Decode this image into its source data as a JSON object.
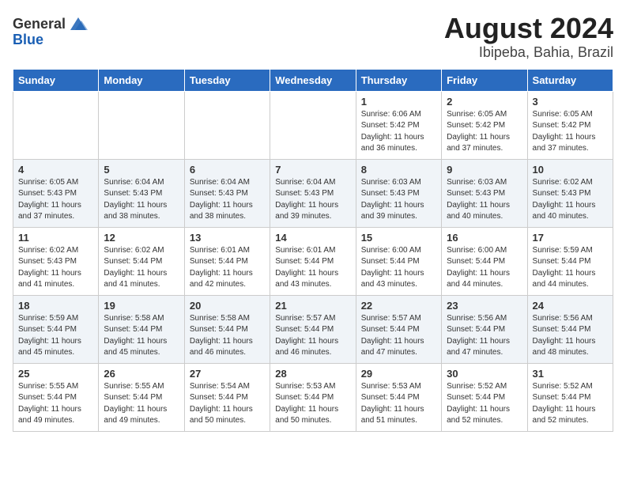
{
  "header": {
    "logo_general": "General",
    "logo_blue": "Blue",
    "title": "August 2024",
    "subtitle": "Ibipeba, Bahia, Brazil"
  },
  "days_of_week": [
    "Sunday",
    "Monday",
    "Tuesday",
    "Wednesday",
    "Thursday",
    "Friday",
    "Saturday"
  ],
  "weeks": [
    {
      "cells": [
        {
          "day": "",
          "info": ""
        },
        {
          "day": "",
          "info": ""
        },
        {
          "day": "",
          "info": ""
        },
        {
          "day": "",
          "info": ""
        },
        {
          "day": "1",
          "info": "Sunrise: 6:06 AM\nSunset: 5:42 PM\nDaylight: 11 hours and 36 minutes."
        },
        {
          "day": "2",
          "info": "Sunrise: 6:05 AM\nSunset: 5:42 PM\nDaylight: 11 hours and 37 minutes."
        },
        {
          "day": "3",
          "info": "Sunrise: 6:05 AM\nSunset: 5:42 PM\nDaylight: 11 hours and 37 minutes."
        }
      ]
    },
    {
      "cells": [
        {
          "day": "4",
          "info": "Sunrise: 6:05 AM\nSunset: 5:43 PM\nDaylight: 11 hours and 37 minutes."
        },
        {
          "day": "5",
          "info": "Sunrise: 6:04 AM\nSunset: 5:43 PM\nDaylight: 11 hours and 38 minutes."
        },
        {
          "day": "6",
          "info": "Sunrise: 6:04 AM\nSunset: 5:43 PM\nDaylight: 11 hours and 38 minutes."
        },
        {
          "day": "7",
          "info": "Sunrise: 6:04 AM\nSunset: 5:43 PM\nDaylight: 11 hours and 39 minutes."
        },
        {
          "day": "8",
          "info": "Sunrise: 6:03 AM\nSunset: 5:43 PM\nDaylight: 11 hours and 39 minutes."
        },
        {
          "day": "9",
          "info": "Sunrise: 6:03 AM\nSunset: 5:43 PM\nDaylight: 11 hours and 40 minutes."
        },
        {
          "day": "10",
          "info": "Sunrise: 6:02 AM\nSunset: 5:43 PM\nDaylight: 11 hours and 40 minutes."
        }
      ]
    },
    {
      "cells": [
        {
          "day": "11",
          "info": "Sunrise: 6:02 AM\nSunset: 5:43 PM\nDaylight: 11 hours and 41 minutes."
        },
        {
          "day": "12",
          "info": "Sunrise: 6:02 AM\nSunset: 5:44 PM\nDaylight: 11 hours and 41 minutes."
        },
        {
          "day": "13",
          "info": "Sunrise: 6:01 AM\nSunset: 5:44 PM\nDaylight: 11 hours and 42 minutes."
        },
        {
          "day": "14",
          "info": "Sunrise: 6:01 AM\nSunset: 5:44 PM\nDaylight: 11 hours and 43 minutes."
        },
        {
          "day": "15",
          "info": "Sunrise: 6:00 AM\nSunset: 5:44 PM\nDaylight: 11 hours and 43 minutes."
        },
        {
          "day": "16",
          "info": "Sunrise: 6:00 AM\nSunset: 5:44 PM\nDaylight: 11 hours and 44 minutes."
        },
        {
          "day": "17",
          "info": "Sunrise: 5:59 AM\nSunset: 5:44 PM\nDaylight: 11 hours and 44 minutes."
        }
      ]
    },
    {
      "cells": [
        {
          "day": "18",
          "info": "Sunrise: 5:59 AM\nSunset: 5:44 PM\nDaylight: 11 hours and 45 minutes."
        },
        {
          "day": "19",
          "info": "Sunrise: 5:58 AM\nSunset: 5:44 PM\nDaylight: 11 hours and 45 minutes."
        },
        {
          "day": "20",
          "info": "Sunrise: 5:58 AM\nSunset: 5:44 PM\nDaylight: 11 hours and 46 minutes."
        },
        {
          "day": "21",
          "info": "Sunrise: 5:57 AM\nSunset: 5:44 PM\nDaylight: 11 hours and 46 minutes."
        },
        {
          "day": "22",
          "info": "Sunrise: 5:57 AM\nSunset: 5:44 PM\nDaylight: 11 hours and 47 minutes."
        },
        {
          "day": "23",
          "info": "Sunrise: 5:56 AM\nSunset: 5:44 PM\nDaylight: 11 hours and 47 minutes."
        },
        {
          "day": "24",
          "info": "Sunrise: 5:56 AM\nSunset: 5:44 PM\nDaylight: 11 hours and 48 minutes."
        }
      ]
    },
    {
      "cells": [
        {
          "day": "25",
          "info": "Sunrise: 5:55 AM\nSunset: 5:44 PM\nDaylight: 11 hours and 49 minutes."
        },
        {
          "day": "26",
          "info": "Sunrise: 5:55 AM\nSunset: 5:44 PM\nDaylight: 11 hours and 49 minutes."
        },
        {
          "day": "27",
          "info": "Sunrise: 5:54 AM\nSunset: 5:44 PM\nDaylight: 11 hours and 50 minutes."
        },
        {
          "day": "28",
          "info": "Sunrise: 5:53 AM\nSunset: 5:44 PM\nDaylight: 11 hours and 50 minutes."
        },
        {
          "day": "29",
          "info": "Sunrise: 5:53 AM\nSunset: 5:44 PM\nDaylight: 11 hours and 51 minutes."
        },
        {
          "day": "30",
          "info": "Sunrise: 5:52 AM\nSunset: 5:44 PM\nDaylight: 11 hours and 52 minutes."
        },
        {
          "day": "31",
          "info": "Sunrise: 5:52 AM\nSunset: 5:44 PM\nDaylight: 11 hours and 52 minutes."
        }
      ]
    }
  ]
}
